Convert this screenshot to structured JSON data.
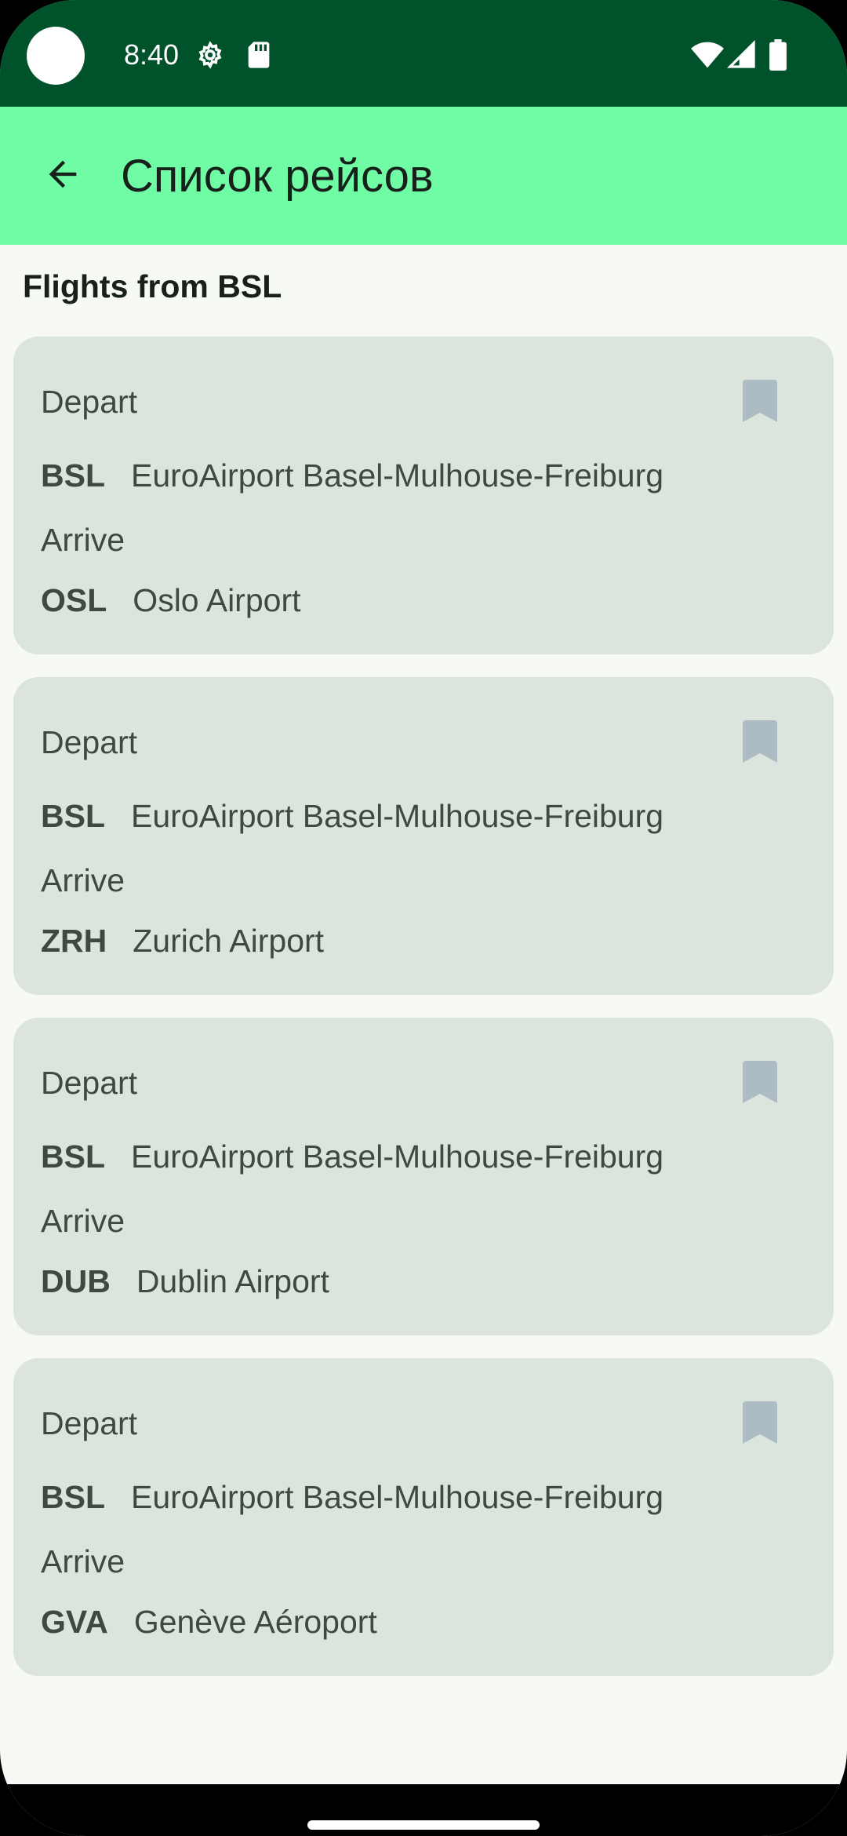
{
  "status_bar": {
    "time": "8:40",
    "icons_left": [
      "settings-gear-icon",
      "sd-card-icon"
    ],
    "icons_right": [
      "wifi-icon",
      "cellular-signal-icon",
      "battery-icon"
    ]
  },
  "app_bar": {
    "title": "Список рейсов",
    "back_icon": "arrow-back-icon"
  },
  "section": {
    "title": "Flights from BSL"
  },
  "flights": [
    {
      "depart_label": "Depart",
      "depart_code": "BSL",
      "depart_name": "EuroAirport Basel-Mulhouse-Freiburg",
      "arrive_label": "Arrive",
      "arrive_code": "OSL",
      "arrive_name": "Oslo Airport",
      "bookmark_icon": "bookmark-icon"
    },
    {
      "depart_label": "Depart",
      "depart_code": "BSL",
      "depart_name": "EuroAirport Basel-Mulhouse-Freiburg",
      "arrive_label": "Arrive",
      "arrive_code": "ZRH",
      "arrive_name": "Zurich Airport",
      "bookmark_icon": "bookmark-icon"
    },
    {
      "depart_label": "Depart",
      "depart_code": "BSL",
      "depart_name": "EuroAirport Basel-Mulhouse-Freiburg",
      "arrive_label": "Arrive",
      "arrive_code": "DUB",
      "arrive_name": "Dublin Airport",
      "bookmark_icon": "bookmark-icon"
    },
    {
      "depart_label": "Depart",
      "depart_code": "BSL",
      "depart_name": "EuroAirport Basel-Mulhouse-Freiburg",
      "arrive_label": "Arrive",
      "arrive_code": "GVA",
      "arrive_name": "Genève Aéroport",
      "bookmark_icon": "bookmark-icon"
    }
  ],
  "colors": {
    "status_bar": "#00522b",
    "app_bar": "#6ffca4",
    "background": "#f6f9f4",
    "card": "#dbe4dd",
    "card_text": "#3f4943",
    "bookmark": "#adbbc3"
  }
}
